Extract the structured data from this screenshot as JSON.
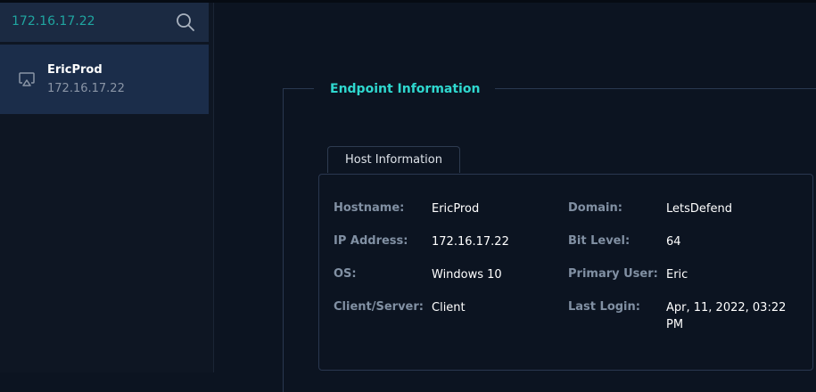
{
  "search": {
    "value": "172.16.17.22"
  },
  "sidebar": {
    "items": [
      {
        "name": "EricProd",
        "ip": "172.16.17.22"
      }
    ]
  },
  "section": {
    "title": "Endpoint Information"
  },
  "tabs": [
    {
      "label": "Host Information"
    }
  ],
  "host_info": {
    "hostname": {
      "label": "Hostname:",
      "value": "EricProd"
    },
    "ip_address": {
      "label": "IP Address:",
      "value": "172.16.17.22"
    },
    "os": {
      "label": "OS:",
      "value": "Windows 10"
    },
    "client_server": {
      "label": "Client/Server:",
      "value": "Client"
    },
    "domain": {
      "label": "Domain:",
      "value": "LetsDefend"
    },
    "bit_level": {
      "label": "Bit Level:",
      "value": "64"
    },
    "primary_user": {
      "label": "Primary User:",
      "value": "Eric"
    },
    "last_login": {
      "label": "Last Login:",
      "value": "Apr, 11, 2022, 03:22 PM"
    }
  },
  "colors": {
    "accent": "#2fd8cf",
    "search_text": "#1fa5a0",
    "background": "#0c1421"
  },
  "icons": {
    "search": "search-icon",
    "device": "monitor-icon"
  }
}
